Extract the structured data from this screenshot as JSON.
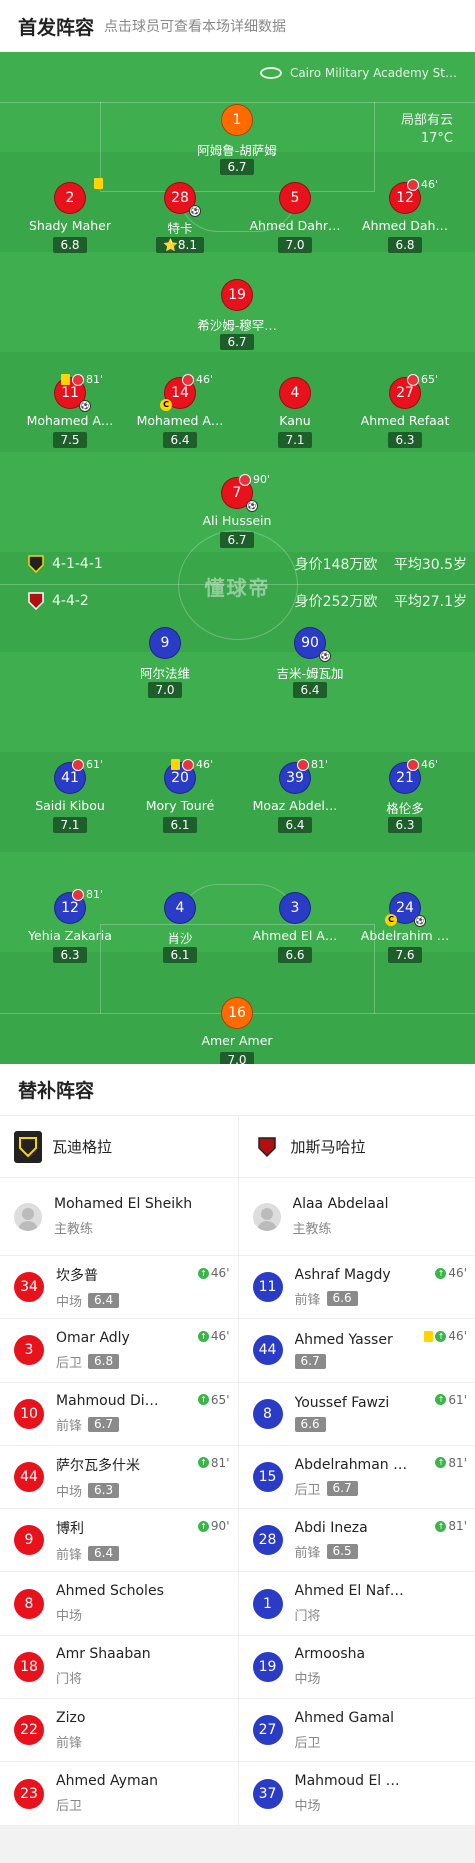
{
  "header": {
    "title": "首发阵容",
    "subtitle": "点击球员可查看本场详细数据"
  },
  "venue": {
    "name": "Cairo Military Academy St…",
    "weather": "局部有云",
    "temp": "17°C"
  },
  "home_team": {
    "formation": "4-1-4-1",
    "valuation": "身价148万欧",
    "avg_age": "平均30.5岁",
    "name": "瓦迪格拉",
    "color": "#e8121d"
  },
  "away_team": {
    "formation": "4-4-2",
    "valuation": "身价252万欧",
    "avg_age": "平均27.1岁",
    "name": "加斯马哈拉",
    "color": "#2a3cc6"
  },
  "watermark": "懂球帝",
  "home_players": [
    {
      "num": "1",
      "name": "阿姆鲁-胡萨姆",
      "rating": "6.7",
      "gk": true
    },
    {
      "num": "2",
      "name": "Shady Maher",
      "rating": "6.8",
      "ycard": true
    },
    {
      "num": "28",
      "name": "特卡",
      "rating": "8.1",
      "ball": true,
      "star": "⭐"
    },
    {
      "num": "5",
      "name": "Ahmed Dahr…",
      "rating": "7.0"
    },
    {
      "num": "12",
      "name": "Ahmed Dah…",
      "rating": "6.8",
      "subout": "46'"
    },
    {
      "num": "19",
      "name": "希沙姆-穆罕…",
      "rating": "6.7"
    },
    {
      "num": "11",
      "name": "Mohamed A…",
      "rating": "7.5",
      "ycard": true,
      "subout": "81'",
      "ball": true
    },
    {
      "num": "14",
      "name": "Mohamed A…",
      "rating": "6.4",
      "subout": "46'",
      "captain": "C"
    },
    {
      "num": "4",
      "name": "Kanu",
      "rating": "7.1"
    },
    {
      "num": "27",
      "name": "Ahmed Refaat",
      "rating": "6.3",
      "subout": "65'"
    },
    {
      "num": "7",
      "name": "Ali Hussein",
      "rating": "6.7",
      "subout": "90'",
      "ball": true
    }
  ],
  "away_players": [
    {
      "num": "9",
      "name": "阿尔法维",
      "rating": "7.0"
    },
    {
      "num": "90",
      "name": "吉米-姆瓦加",
      "rating": "6.4",
      "ball": true
    },
    {
      "num": "41",
      "name": "Saidi Kibou",
      "rating": "7.1",
      "subout": "61'"
    },
    {
      "num": "20",
      "name": "Mory Touré",
      "rating": "6.1",
      "ycard": true,
      "subout": "46'"
    },
    {
      "num": "39",
      "name": "Moaz Abdel…",
      "rating": "6.4",
      "subout": "81'"
    },
    {
      "num": "21",
      "name": "格伦多",
      "rating": "6.3",
      "subout": "46'"
    },
    {
      "num": "12",
      "name": "Yehia Zakaria",
      "rating": "6.3",
      "subout": "81'"
    },
    {
      "num": "4",
      "name": "肖沙",
      "rating": "6.1"
    },
    {
      "num": "3",
      "name": "Ahmed El A…",
      "rating": "6.6"
    },
    {
      "num": "24",
      "name": "Abdelrahim …",
      "rating": "7.6",
      "captain": "C",
      "ball": true
    },
    {
      "num": "16",
      "name": "Amer Amer",
      "rating": "7.0",
      "gk": true
    }
  ],
  "subs_title": "替补阵容",
  "home_coach": {
    "name": "Mohamed El Sheikh",
    "role": "主教练"
  },
  "away_coach": {
    "name": "Alaa Abdelaal",
    "role": "主教练"
  },
  "home_subs": [
    {
      "num": "34",
      "name": "坎多普",
      "pos": "中场",
      "rating": "6.4",
      "in": "46'"
    },
    {
      "num": "3",
      "name": "Omar Adly",
      "pos": "后卫",
      "rating": "6.8",
      "in": "46'"
    },
    {
      "num": "10",
      "name": "Mahmoud Di…",
      "pos": "前锋",
      "rating": "6.7",
      "in": "65'"
    },
    {
      "num": "44",
      "name": "萨尔瓦多什米",
      "pos": "中场",
      "rating": "6.3",
      "in": "81'"
    },
    {
      "num": "9",
      "name": "博利",
      "pos": "前锋",
      "rating": "6.4",
      "in": "90'"
    },
    {
      "num": "8",
      "name": "Ahmed Scholes",
      "pos": "中场"
    },
    {
      "num": "18",
      "name": "Amr Shaaban",
      "pos": "门将"
    },
    {
      "num": "22",
      "name": "Zizo",
      "pos": "前锋"
    },
    {
      "num": "23",
      "name": "Ahmed Ayman",
      "pos": "后卫"
    }
  ],
  "away_subs": [
    {
      "num": "11",
      "name": "Ashraf Magdy",
      "pos": "前锋",
      "rating": "6.6",
      "in": "46'"
    },
    {
      "num": "44",
      "name": "Ahmed Yasser",
      "pos": "",
      "rating": "6.7",
      "in": "46'",
      "ycard": true
    },
    {
      "num": "8",
      "name": "Youssef Fawzi",
      "pos": "",
      "rating": "6.6",
      "in": "61'"
    },
    {
      "num": "15",
      "name": "Abdelrahman …",
      "pos": "后卫",
      "rating": "6.7",
      "in": "81'"
    },
    {
      "num": "28",
      "name": "Abdi Ineza",
      "pos": "前锋",
      "rating": "6.5",
      "in": "81'"
    },
    {
      "num": "1",
      "name": "Ahmed El Naf…",
      "pos": "门将"
    },
    {
      "num": "19",
      "name": "Armoosha",
      "pos": "中场"
    },
    {
      "num": "27",
      "name": "Ahmed Gamal",
      "pos": "后卫"
    },
    {
      "num": "37",
      "name": "Mahmoud El …",
      "pos": "中场"
    }
  ]
}
